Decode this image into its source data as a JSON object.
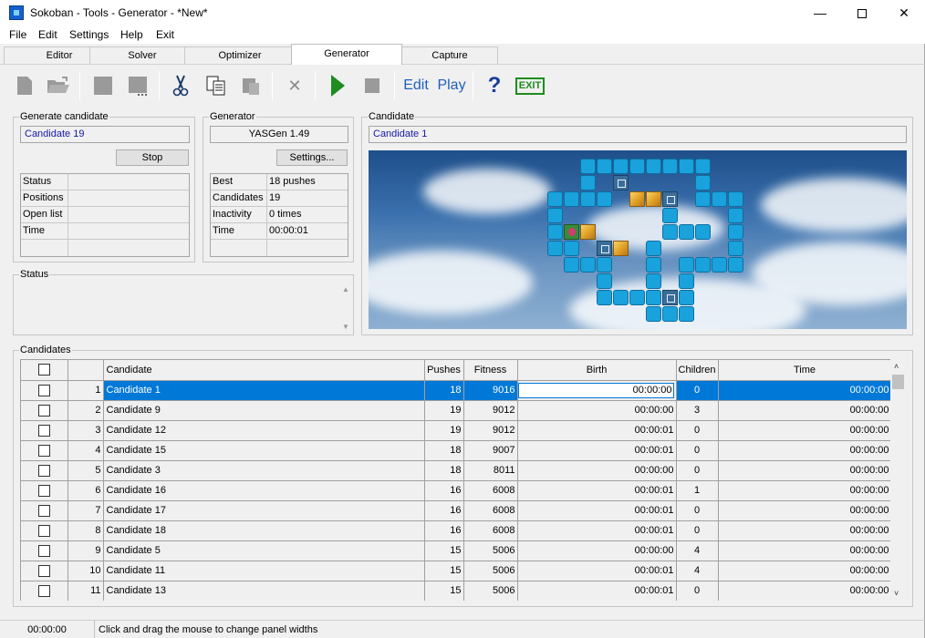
{
  "window": {
    "title": "Sokoban - Tools - Generator - *New*"
  },
  "menu": {
    "items": [
      "File",
      "Edit",
      "Settings",
      "Help",
      "Exit"
    ]
  },
  "tabs": [
    "Editor",
    "Solver",
    "Optimizer",
    "Generator",
    "Capture"
  ],
  "active_tab": "Generator",
  "toolbar": {
    "edit_label": "Edit",
    "play_label": "Play",
    "help_label": "?",
    "exit_label": "EXIT"
  },
  "generate_candidate": {
    "title": "Generate candidate",
    "current": "Candidate 19",
    "stop_label": "Stop",
    "rows": [
      {
        "label": "Status",
        "value": ""
      },
      {
        "label": "Positions",
        "value": ""
      },
      {
        "label": "Open list",
        "value": ""
      },
      {
        "label": "Time",
        "value": ""
      },
      {
        "label": "",
        "value": ""
      }
    ]
  },
  "generator": {
    "title": "Generator",
    "name": "YASGen 1.49",
    "settings_label": "Settings...",
    "rows": [
      {
        "label": "Best",
        "value": "18 pushes"
      },
      {
        "label": "Candidates",
        "value": "19"
      },
      {
        "label": "Inactivity",
        "value": "0 times"
      },
      {
        "label": "Time",
        "value": "00:00:01"
      },
      {
        "label": "",
        "value": ""
      }
    ]
  },
  "candidate": {
    "title": "Candidate",
    "name": "Candidate 1"
  },
  "status": {
    "title": "Status",
    "text": ""
  },
  "candidates": {
    "title": "Candidates",
    "columns": [
      "",
      "",
      "Candidate",
      "Pushes",
      "Fitness",
      "Birth",
      "Children",
      "Time"
    ],
    "rows": [
      {
        "n": "1",
        "name": "Candidate 1",
        "pushes": "18",
        "fitness": "9016",
        "birth": "00:00:00",
        "children": "0",
        "time": "00:00:00"
      },
      {
        "n": "2",
        "name": "Candidate 9",
        "pushes": "19",
        "fitness": "9012",
        "birth": "00:00:00",
        "children": "3",
        "time": "00:00:00"
      },
      {
        "n": "3",
        "name": "Candidate 12",
        "pushes": "19",
        "fitness": "9012",
        "birth": "00:00:01",
        "children": "0",
        "time": "00:00:00"
      },
      {
        "n": "4",
        "name": "Candidate 15",
        "pushes": "18",
        "fitness": "9007",
        "birth": "00:00:01",
        "children": "0",
        "time": "00:00:00"
      },
      {
        "n": "5",
        "name": "Candidate 3",
        "pushes": "18",
        "fitness": "8011",
        "birth": "00:00:00",
        "children": "0",
        "time": "00:00:00"
      },
      {
        "n": "6",
        "name": "Candidate 16",
        "pushes": "16",
        "fitness": "6008",
        "birth": "00:00:01",
        "children": "1",
        "time": "00:00:00"
      },
      {
        "n": "7",
        "name": "Candidate 17",
        "pushes": "16",
        "fitness": "6008",
        "birth": "00:00:01",
        "children": "0",
        "time": "00:00:00"
      },
      {
        "n": "8",
        "name": "Candidate 18",
        "pushes": "16",
        "fitness": "6008",
        "birth": "00:00:01",
        "children": "0",
        "time": "00:00:00"
      },
      {
        "n": "9",
        "name": "Candidate 5",
        "pushes": "15",
        "fitness": "5006",
        "birth": "00:00:00",
        "children": "4",
        "time": "00:00:00"
      },
      {
        "n": "10",
        "name": "Candidate 11",
        "pushes": "15",
        "fitness": "5006",
        "birth": "00:00:01",
        "children": "4",
        "time": "00:00:00"
      },
      {
        "n": "11",
        "name": "Candidate 13",
        "pushes": "15",
        "fitness": "5006",
        "birth": "00:00:01",
        "children": "0",
        "time": "00:00:00"
      }
    ]
  },
  "statusbar": {
    "time": "00:00:00",
    "message": "Click and drag the mouse to change panel widths"
  },
  "colors": {
    "selection": "#0078d7",
    "link_blue": "#1f5ebd",
    "play_green": "#1e8c1e",
    "wall": "#1aa2dc"
  }
}
